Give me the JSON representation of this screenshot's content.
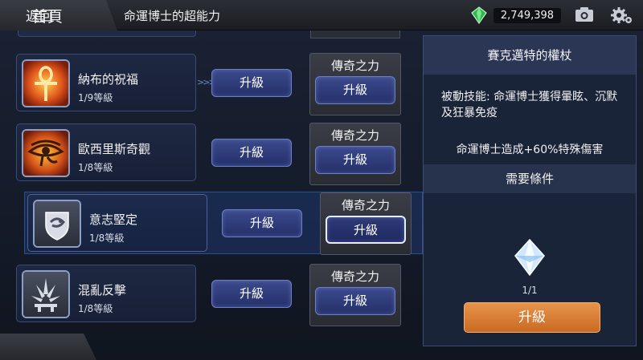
{
  "header": {
    "home_label": "首頁",
    "title": "命運博士的超能力",
    "gem_count": "2,749,398"
  },
  "skills": [
    {
      "name": "納布的祝福",
      "level": "1/9等級",
      "upgrade_label": "升級",
      "legendary_label": "傳奇之力",
      "legendary_upgrade_label": "升級",
      "icon": "ankh-icon"
    },
    {
      "name": "歐西里斯奇觀",
      "level": "1/8等級",
      "upgrade_label": "升級",
      "legendary_label": "傳奇之力",
      "legendary_upgrade_label": "升級",
      "icon": "eye-of-horus-icon"
    },
    {
      "name": "意志堅定",
      "level": "1/8等級",
      "upgrade_label": "升級",
      "legendary_label": "傳奇之力",
      "legendary_upgrade_label": "升級",
      "icon": "shield-icon"
    },
    {
      "name": "混亂反擊",
      "level": "1/8等級",
      "upgrade_label": "升級",
      "legendary_label": "傳奇之力",
      "legendary_upgrade_label": "升級",
      "icon": "chaos-burst-icon"
    }
  ],
  "detail": {
    "title": "賽克邁特的權杖",
    "desc1": "被動技能: 命運博士獲得暈眩、沉默及狂暴免疫",
    "desc2": "命運博士造成+60%特殊傷害",
    "requirements_header": "需要條件",
    "requirement_count": "1/1",
    "upgrade_label": "升級"
  },
  "footer": {
    "back_label": "返回"
  },
  "colors": {
    "accent_blue": "#3b4a8c",
    "accent_orange": "#e8934a",
    "gem_green": "#39c25a"
  }
}
